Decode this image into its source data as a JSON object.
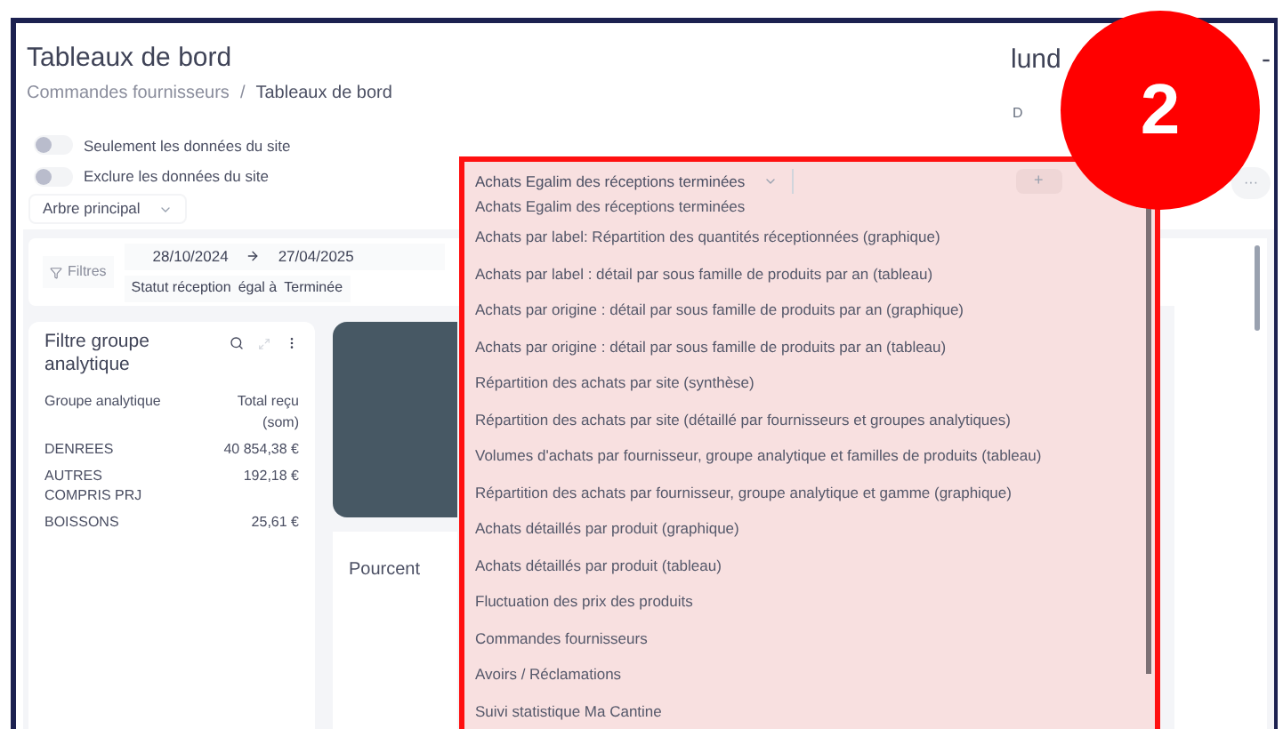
{
  "header": {
    "title": "Tableaux de bord",
    "breadcrumb": [
      {
        "label": "Commandes fournisseurs",
        "current": false
      },
      {
        "label": "Tableaux de bord",
        "current": true
      }
    ],
    "breadcrumb_separator": "/",
    "date_heading": "lund",
    "date_heading_end": "-",
    "date_sub": "D"
  },
  "toggles": [
    {
      "label": "Seulement les données du site",
      "on": false
    },
    {
      "label": "Exclure les données du site",
      "on": false
    }
  ],
  "tree_select": {
    "value": "Arbre principal"
  },
  "filters": {
    "button": "Filtres",
    "date_from": "28/10/2024",
    "date_to": "27/04/2025",
    "condition": {
      "field": "Statut réception",
      "operator": "égal à",
      "value": "Terminée"
    }
  },
  "group_card": {
    "title": "Filtre groupe analytique",
    "columns": [
      "Groupe analytique",
      "Total reçu (som)"
    ],
    "rows": [
      {
        "group": "DENREES",
        "total": "40 854,38 €"
      },
      {
        "group": "AUTRES COMPRIS PRJ",
        "total": "192,18 €"
      },
      {
        "group": "BOISSONS",
        "total": "25,61 €"
      }
    ]
  },
  "pourcent_card": {
    "title": "Pourcent"
  },
  "dashboard_select": {
    "value": "Achats Egalim des réceptions terminées",
    "options": [
      "Achats Egalim des réceptions terminées",
      "Achats par label: Répartition des quantités réceptionnées (graphique)",
      "Achats par label : détail par sous famille de produits par an (tableau)",
      "Achats par origine : détail par sous famille de produits par an (graphique)",
      "Achats par origine : détail par sous famille de produits par an (tableau)",
      "Répartition des achats par site (synthèse)",
      "Répartition des achats par site (détaillé par fournisseurs et groupes analytiques)",
      "Volumes d'achats par fournisseur, groupe analytique et familles de produits (tableau)",
      "Répartition des achats par fournisseur, groupe analytique et gamme (graphique)",
      "Achats détaillés par produit (graphique)",
      "Achats détaillés par produit (tableau)",
      "Fluctuation des prix des produits",
      "Commandes fournisseurs",
      "Avoirs / Réclamations",
      "Suivi statistique Ma Cantine"
    ]
  },
  "add_button": "+",
  "more_button": "···",
  "step_badge": "2"
}
